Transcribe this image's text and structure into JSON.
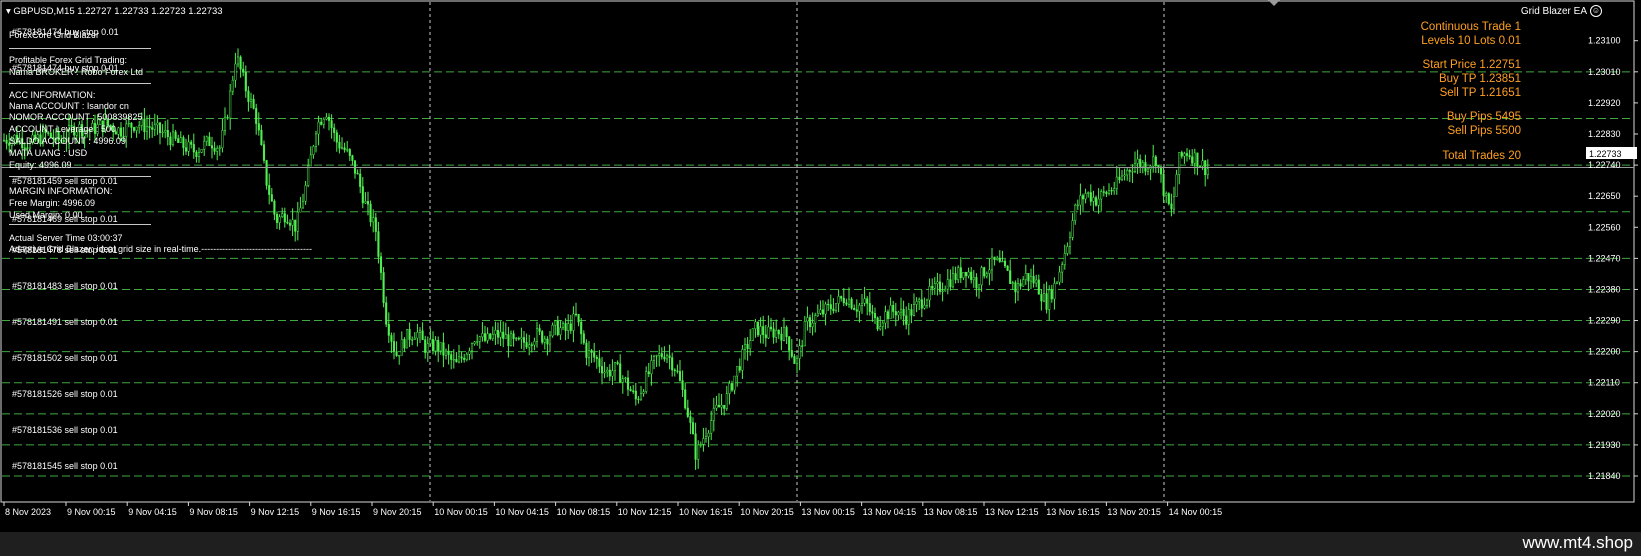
{
  "window": {
    "symbol_header": "GBPUSD,M15  1.22727 1.22733 1.22723 1.22733",
    "ea_name": "Grid Blazer EA",
    "watermark": "www.mt4.shop"
  },
  "colors": {
    "background": "#000000",
    "candle": "#50f050",
    "grid_orders": "#3fa83f",
    "axis_text": "#ffffff",
    "panel_text": "#ff9f20",
    "price_line": "#9a9a9a"
  },
  "icons": {
    "smiley": "smiley-icon",
    "dropdown": "triangle-down-icon",
    "shift": "chart-shift-icon"
  },
  "info_panel": {
    "title": "ForexCore Grid Blazer",
    "buy_order": "#578181474 buy stop 0.01",
    "buy_order_2": "#578181474 buy stop 0.01",
    "promo_title": "Profitable Forex Grid Trading:",
    "broker": "Nama BROKER : Robo Forex Ltd",
    "acc_title": "ACC INFORMATION:",
    "name": "Nama ACCOUNT : Isandor cn",
    "number": "NOMOR ACCOUNT :  500839825",
    "leverage": "ACCOUNT Leverage :  500",
    "balance": " SALDO ACCOUNT :   4996.09",
    "currency": "MATA UANG :   USD",
    "equity": " Equity:        4996.09",
    "margin_title": "MARGIN INFORMATION:",
    "free_margin": "Free Margin:          4996.09",
    "used_margin": "Used Margin:           0.00",
    "server_time": "Actual Server Time     03:00:37",
    "adaptive": "Adaptive Grid Blazer: ideal grid size in real-time.-------------------------------------",
    "order_459": "#578181459 sell stop 0.01",
    "order_469": "#578181469 sell stop 0.01",
    "order_478": "#578181478 sell stop 0.01",
    "order_483": "#578181483 sell stop 0.01",
    "order_491": "#578181491 sell stop 0.01",
    "order_502": "#578181502 sell stop 0.01",
    "order_526": "#578181526 sell stop 0.01",
    "order_536": "#578181536 sell stop 0.01",
    "order_545": "#578181545 sell stop 0.01"
  },
  "ea_panel": {
    "continuous": "Continuous Trade 1",
    "levels": "Levels 10   Lots 0.01",
    "start_price": "Start Price 1.22751",
    "buy_tp": "Buy TP 1.23851",
    "sell_tp": "Sell TP 1.21651",
    "buy_pips": "Buy Pips  5495",
    "sell_pips": "Sell Pips  5500",
    "total_trades": "Total Trades  20"
  },
  "chart_data": {
    "type": "candlestick",
    "symbol": "GBPUSD",
    "timeframe": "M15",
    "current_price": "1.22733",
    "ylim": [
      1.2184,
      1.2316
    ],
    "price_ticks": [
      "1.23100",
      "1.23010",
      "1.22920",
      "1.22830",
      "1.22740",
      "1.22650",
      "1.22560",
      "1.22470",
      "1.22380",
      "1.22290",
      "1.22200",
      "1.22110",
      "1.22020",
      "1.21930",
      "1.21840"
    ],
    "time_ticks": [
      "8 Nov 2023",
      "9 Nov 00:15",
      "9 Nov 04:15",
      "9 Nov 08:15",
      "9 Nov 12:15",
      "9 Nov 16:15",
      "9 Nov 20:15",
      "10 Nov 00:15",
      "10 Nov 04:15",
      "10 Nov 08:15",
      "10 Nov 12:15",
      "10 Nov 16:15",
      "10 Nov 20:15",
      "13 Nov 00:15",
      "13 Nov 04:15",
      "13 Nov 08:15",
      "13 Nov 12:15",
      "13 Nov 16:15",
      "13 Nov 20:15",
      "14 Nov 00:15"
    ],
    "grid_order_levels": [
      1.2301,
      1.22875,
      1.2274,
      1.22605,
      1.2247,
      1.2238,
      1.2229,
      1.222,
      1.2211,
      1.2202,
      1.2193,
      1.2184
    ],
    "day_separators": [
      "9 Nov",
      "10 Nov",
      "13 Nov",
      "14 Nov"
    ],
    "close_path": [
      [
        0,
        1.2281
      ],
      [
        15,
        1.2282
      ],
      [
        30,
        1.228
      ],
      [
        45,
        1.2283
      ],
      [
        60,
        1.2281
      ],
      [
        75,
        1.2285
      ],
      [
        90,
        1.2284
      ],
      [
        105,
        1.2286
      ],
      [
        120,
        1.2284
      ],
      [
        135,
        1.2286
      ],
      [
        150,
        1.2285
      ],
      [
        165,
        1.2283
      ],
      [
        180,
        1.228
      ],
      [
        195,
        1.2278
      ],
      [
        210,
        1.2281
      ],
      [
        220,
        1.2279
      ],
      [
        228,
        1.229
      ],
      [
        236,
        1.2306
      ],
      [
        246,
        1.2296
      ],
      [
        256,
        1.2288
      ],
      [
        266,
        1.227
      ],
      [
        276,
        1.2258
      ],
      [
        286,
        1.226
      ],
      [
        296,
        1.2256
      ],
      [
        306,
        1.2268
      ],
      [
        316,
        1.2285
      ],
      [
        326,
        1.229
      ],
      [
        336,
        1.2281
      ],
      [
        346,
        1.2278
      ],
      [
        356,
        1.2272
      ],
      [
        366,
        1.2262
      ],
      [
        376,
        1.2255
      ],
      [
        386,
        1.223
      ],
      [
        396,
        1.2219
      ],
      [
        406,
        1.2224
      ],
      [
        416,
        1.2226
      ],
      [
        426,
        1.2221
      ],
      [
        436,
        1.2222
      ],
      [
        446,
        1.2219
      ],
      [
        456,
        1.2216
      ],
      [
        466,
        1.222
      ],
      [
        476,
        1.2225
      ],
      [
        486,
        1.2223
      ],
      [
        496,
        1.2225
      ],
      [
        506,
        1.2224
      ],
      [
        516,
        1.2222
      ],
      [
        526,
        1.2223
      ],
      [
        536,
        1.2225
      ],
      [
        546,
        1.2224
      ],
      [
        556,
        1.2227
      ],
      [
        566,
        1.2226
      ],
      [
        576,
        1.223
      ],
      [
        586,
        1.222
      ],
      [
        596,
        1.2218
      ],
      [
        606,
        1.2214
      ],
      [
        616,
        1.2215
      ],
      [
        626,
        1.2211
      ],
      [
        636,
        1.2206
      ],
      [
        646,
        1.2212
      ],
      [
        656,
        1.2218
      ],
      [
        666,
        1.222
      ],
      [
        676,
        1.2215
      ],
      [
        686,
        1.2205
      ],
      [
        696,
        1.219
      ],
      [
        706,
        1.2197
      ],
      [
        716,
        1.2203
      ],
      [
        726,
        1.2206
      ],
      [
        736,
        1.2214
      ],
      [
        746,
        1.2221
      ],
      [
        756,
        1.2227
      ],
      [
        766,
        1.2225
      ],
      [
        776,
        1.2226
      ],
      [
        786,
        1.2225
      ],
      [
        796,
        1.2216
      ],
      [
        806,
        1.2228
      ],
      [
        816,
        1.223
      ],
      [
        826,
        1.2232
      ],
      [
        836,
        1.2234
      ],
      [
        846,
        1.2236
      ],
      [
        856,
        1.2233
      ],
      [
        866,
        1.2234
      ],
      [
        876,
        1.2228
      ],
      [
        886,
        1.2231
      ],
      [
        896,
        1.2232
      ],
      [
        906,
        1.223
      ],
      [
        916,
        1.2233
      ],
      [
        926,
        1.2236
      ],
      [
        936,
        1.2238
      ],
      [
        946,
        1.224
      ],
      [
        956,
        1.2242
      ],
      [
        966,
        1.2244
      ],
      [
        976,
        1.224
      ],
      [
        986,
        1.2244
      ],
      [
        996,
        1.2246
      ],
      [
        1006,
        1.2243
      ],
      [
        1016,
        1.2238
      ],
      [
        1026,
        1.2242
      ],
      [
        1036,
        1.224
      ],
      [
        1046,
        1.2234
      ],
      [
        1056,
        1.224
      ],
      [
        1066,
        1.225
      ],
      [
        1076,
        1.2262
      ],
      [
        1086,
        1.2266
      ],
      [
        1096,
        1.2264
      ],
      [
        1106,
        1.2266
      ],
      [
        1116,
        1.2268
      ],
      [
        1126,
        1.2272
      ],
      [
        1136,
        1.2275
      ],
      [
        1146,
        1.2274
      ],
      [
        1156,
        1.2276
      ],
      [
        1166,
        1.2264
      ],
      [
        1172,
        1.226
      ],
      [
        1178,
        1.2275
      ],
      [
        1186,
        1.2278
      ],
      [
        1196,
        1.2276
      ],
      [
        1206,
        1.2273
      ]
    ]
  }
}
